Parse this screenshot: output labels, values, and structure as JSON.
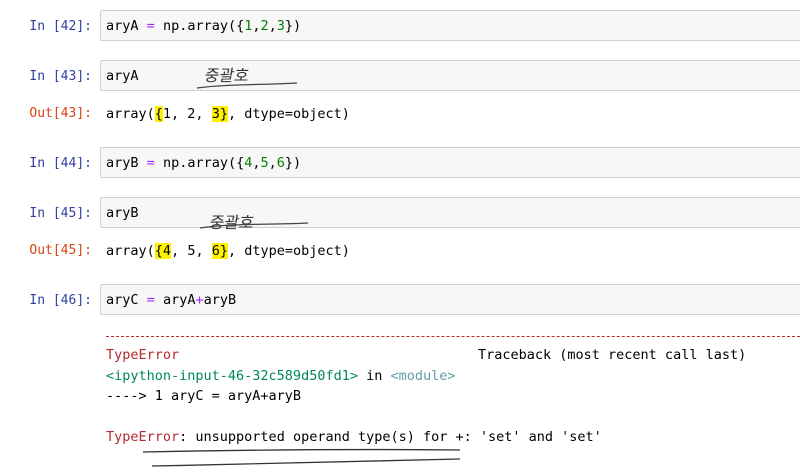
{
  "cells": [
    {
      "prompt": "In [42]:",
      "code": {
        "v1": "aryA",
        "eq": "=",
        "fn": "np.array({",
        "n1": "1",
        "c1": ",",
        "n2": "2",
        "c2": ",",
        "n3": "3",
        "end": "})"
      }
    },
    {
      "prompt": "In [43]:",
      "code": "aryA",
      "annotation": "중괄호",
      "out_prompt": "Out[43]:",
      "out": {
        "pre": "array(",
        "b1": "{",
        "v1": "1, 2, ",
        "v3": "3",
        "b2": "}",
        "post": ", dtype=object)"
      }
    },
    {
      "prompt": "In [44]:",
      "code": {
        "v1": "aryB",
        "eq": "=",
        "fn": "np.array({",
        "n1": "4",
        "c1": ",",
        "n2": "5",
        "c2": ",",
        "n3": "6",
        "end": "})"
      }
    },
    {
      "prompt": "In [45]:",
      "code": "aryB",
      "annotation": "중괄호",
      "out_prompt": "Out[45]:",
      "out": {
        "pre": "array(",
        "b1": "{",
        "v1": "4",
        "mid": ", 5, ",
        "v3": "6",
        "b2": "}",
        "post": ", dtype=object)"
      }
    },
    {
      "prompt": "In [46]:",
      "code": {
        "v1": "aryC",
        "eq": "=",
        "a": "aryA",
        "op": "+",
        "b": "aryB"
      }
    }
  ],
  "traceback": {
    "error_name": "TypeError",
    "header_right": "Traceback (most recent call last)",
    "input_ref": "<ipython-input-46-32c589d50fd1>",
    "in_word": "in",
    "module": "<module>",
    "arrow_line": "----> 1 aryC = aryA+aryB",
    "final_error": "TypeError",
    "final_message": ": unsupported operand type(s) for +: 'set' and 'set'"
  },
  "colors": {
    "in_prompt": "#303f9f",
    "out_prompt": "#d84315",
    "number": "#008000",
    "operator": "#aa22ff",
    "error_red": "#b22b31",
    "highlight": "#fff200"
  }
}
